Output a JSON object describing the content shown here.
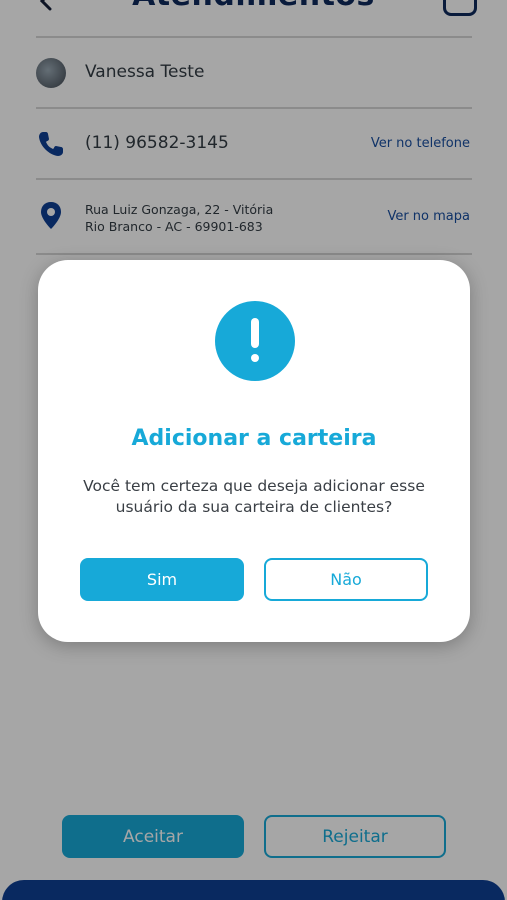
{
  "header": {
    "title": "Atendimentos",
    "back_icon": "chevron-left-icon",
    "action_icon": "calendar-icon"
  },
  "contact": {
    "name": "Vanessa Teste",
    "phone": "(11) 96582-3145",
    "phone_link": "Ver no telefone",
    "address_line1": "Rua Luiz Gonzaga, 22 - Vitória",
    "address_line2": "Rio Branco - AC - 69901-683",
    "address_link": "Ver no mapa"
  },
  "actions": {
    "accept_label": "Aceitar",
    "reject_label": "Rejeitar"
  },
  "modal": {
    "icon": "exclamation-icon",
    "title": "Adicionar a carteira",
    "message": "Você tem certeza que deseja adicionar esse usuário da sua carteira de clientes?",
    "yes_label": "Sim",
    "no_label": "Não"
  },
  "colors": {
    "accent": "#17a9d8",
    "brand_dark": "#0f3f94",
    "link": "#1a4fa0"
  }
}
